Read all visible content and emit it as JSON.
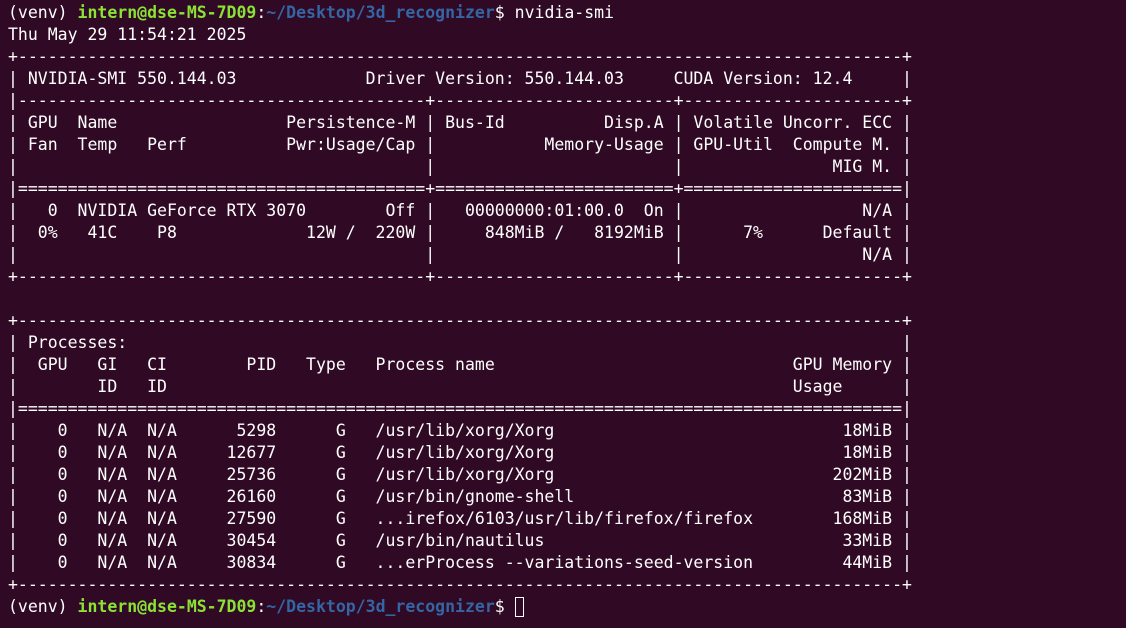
{
  "colors": {
    "background": "#300a24",
    "text": "#ffffff",
    "prompt_user": "#8ae234",
    "prompt_path": "#3465a4"
  },
  "prompt": {
    "venv": "(venv) ",
    "user_host": "intern@dse-MS-7D09",
    "colon": ":",
    "path": "~/Desktop/3d_recognizer",
    "symbol": "$ "
  },
  "command": "nvidia-smi",
  "timestamp": "Thu May 29 11:54:21 2025",
  "output_lines": [
    "+-----------------------------------------------------------------------------------------+",
    "| NVIDIA-SMI 550.144.03             Driver Version: 550.144.03     CUDA Version: 12.4     |",
    "|-----------------------------------------+------------------------+----------------------+",
    "| GPU  Name                 Persistence-M | Bus-Id          Disp.A | Volatile Uncorr. ECC |",
    "| Fan  Temp   Perf          Pwr:Usage/Cap |           Memory-Usage | GPU-Util  Compute M. |",
    "|                                         |                        |               MIG M. |",
    "|=========================================+========================+======================|",
    "|   0  NVIDIA GeForce RTX 3070        Off |   00000000:01:00.0  On |                  N/A |",
    "|  0%   41C    P8             12W /  220W |     848MiB /   8192MiB |      7%      Default |",
    "|                                         |                        |                  N/A |",
    "+-----------------------------------------+------------------------+----------------------+",
    "",
    "+-----------------------------------------------------------------------------------------+",
    "| Processes:                                                                              |",
    "|  GPU   GI   CI        PID   Type   Process name                              GPU Memory |",
    "|        ID   ID                                                               Usage      |",
    "|=========================================================================================|",
    "|    0   N/A  N/A      5298      G   /usr/lib/xorg/Xorg                             18MiB |",
    "|    0   N/A  N/A     12677      G   /usr/lib/xorg/Xorg                             18MiB |",
    "|    0   N/A  N/A     25736      G   /usr/lib/xorg/Xorg                            202MiB |",
    "|    0   N/A  N/A     26160      G   /usr/bin/gnome-shell                           83MiB |",
    "|    0   N/A  N/A     27590      G   ...irefox/6103/usr/lib/firefox/firefox        168MiB |",
    "|    0   N/A  N/A     30454      G   /usr/bin/nautilus                              33MiB |",
    "|    0   N/A  N/A     30834      G   ...erProcess --variations-seed-version         44MiB |",
    "+-----------------------------------------------------------------------------------------+"
  ]
}
